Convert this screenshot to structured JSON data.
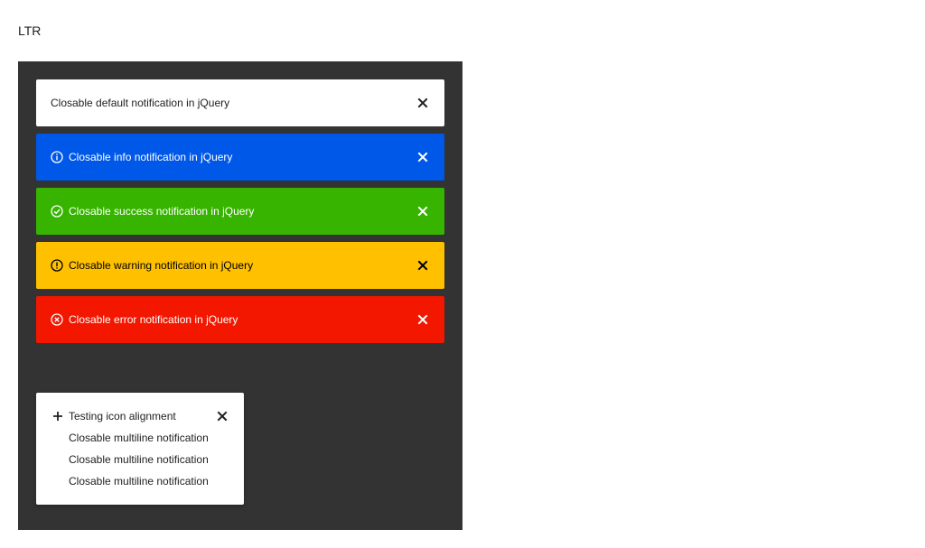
{
  "heading": {
    "direction_label": "LTR"
  },
  "notifications": [
    {
      "type": "default",
      "text": "Closable default notification in jQuery",
      "icon": "",
      "close_icon": "close-icon"
    },
    {
      "type": "info",
      "text": "Closable info notification in jQuery",
      "icon": "info-circle-icon",
      "close_icon": "close-icon"
    },
    {
      "type": "success",
      "text": "Closable success notification in jQuery",
      "icon": "check-circle-icon",
      "close_icon": "close-icon"
    },
    {
      "type": "warning",
      "text": "Closable warning notification in jQuery",
      "icon": "exclamation-circle-icon",
      "close_icon": "close-icon"
    },
    {
      "type": "error",
      "text": "Closable error notification in jQuery",
      "icon": "x-circle-icon",
      "close_icon": "close-icon"
    }
  ],
  "multiline": {
    "icon": "plus-icon",
    "lines": [
      "Testing icon alignment",
      "Closable multiline notification",
      "Closable multiline notification",
      "Closable multiline notification"
    ],
    "close_icon": "close-icon"
  },
  "colors": {
    "panel_bg": "#333333",
    "default": "#ffffff",
    "info": "#0058e9",
    "success": "#37b400",
    "warning": "#ffc000",
    "error": "#f31700"
  }
}
